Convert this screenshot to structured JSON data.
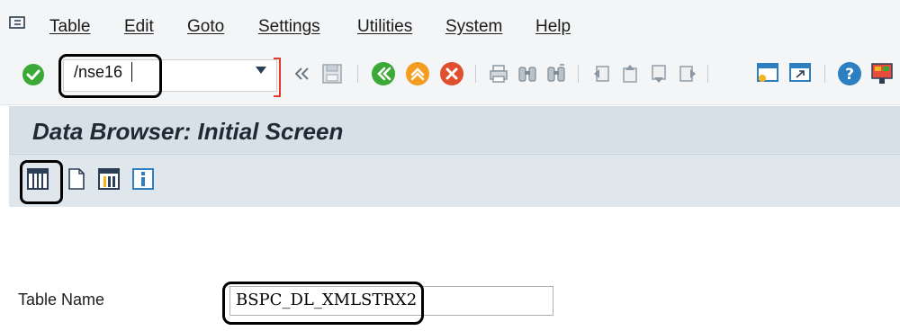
{
  "menu": {
    "items": [
      "Table",
      "Edit",
      "Goto",
      "Settings",
      "Utilities",
      "System",
      "Help"
    ]
  },
  "toolbar": {
    "command_value": "/nse16",
    "icons": [
      "enter-icon",
      "back-arrows-icon",
      "save-icon",
      "back-icon",
      "exit-icon",
      "cancel-icon",
      "print-icon",
      "find-icon",
      "find-next-icon",
      "first-page-icon",
      "previous-page-icon",
      "next-page-icon",
      "last-page-icon",
      "create-session-icon",
      "shortcut-icon",
      "help-icon",
      "customize-layout-icon"
    ]
  },
  "screen": {
    "title": "Data Browser: Initial Screen",
    "app_toolbar_icons": [
      "table-contents-icon",
      "new-entries-icon",
      "table-icon",
      "info-icon"
    ]
  },
  "form": {
    "table_name_label": "Table Name",
    "table_name_value": "BSPC_DL_XMLSTRX2"
  },
  "colors": {
    "toolbar_bg": "#f3f5f7",
    "title_band": "#d8e0e7",
    "green": "#3aa935",
    "orange": "#f39c1f",
    "red": "#e0502f",
    "blue_icon": "#2e7fc1"
  }
}
